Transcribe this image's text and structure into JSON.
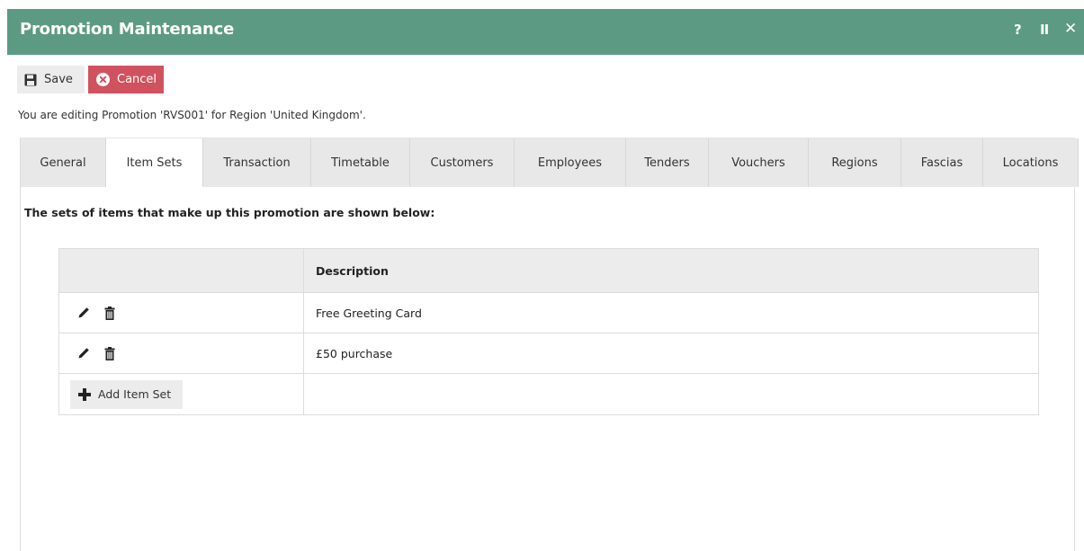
{
  "window": {
    "title": "Promotion Maintenance",
    "controls": {
      "help": "?",
      "pause": "II",
      "close": "✕"
    }
  },
  "toolbar": {
    "save_label": "Save",
    "cancel_label": "Cancel",
    "save_icon": "floppy-disk-icon",
    "cancel_icon": "x-circle-icon"
  },
  "editing_message": "You are editing Promotion 'RVS001' for Region 'United Kingdom'.",
  "tabs": [
    {
      "label": "General",
      "active": false
    },
    {
      "label": "Item Sets",
      "active": true
    },
    {
      "label": "Transaction",
      "active": false
    },
    {
      "label": "Timetable",
      "active": false
    },
    {
      "label": "Customers",
      "active": false
    },
    {
      "label": "Employees",
      "active": false
    },
    {
      "label": "Tenders",
      "active": false
    },
    {
      "label": "Vouchers",
      "active": false
    },
    {
      "label": "Regions",
      "active": false
    },
    {
      "label": "Fascias",
      "active": false
    },
    {
      "label": "Locations",
      "active": false
    }
  ],
  "item_sets": {
    "intro": "The sets of items that make up this promotion are shown below:",
    "columns": {
      "actions": "",
      "description": "Description"
    },
    "rows": [
      {
        "description": "Free Greeting Card"
      },
      {
        "description": "£50 purchase"
      }
    ],
    "add_label": "Add Item Set"
  },
  "colors": {
    "titlebar": "#5c9a84",
    "cancel": "#d1525f"
  }
}
